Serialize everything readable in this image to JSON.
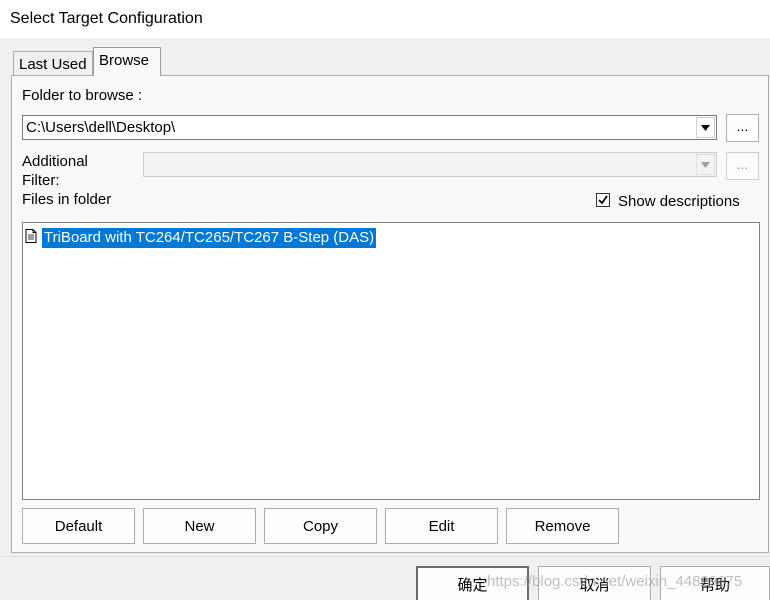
{
  "window": {
    "title": "Select Target Configuration"
  },
  "tabs": [
    {
      "label": "Last Used",
      "active": false
    },
    {
      "label": "Browse",
      "active": true
    }
  ],
  "folder": {
    "label": "Folder to browse :",
    "value": "C:\\Users\\dell\\Desktop\\",
    "browse_label": "..."
  },
  "filter": {
    "label_line1": "Additional",
    "label_line2": "Filter:",
    "value": "",
    "browse_label": "...",
    "enabled": false
  },
  "files": {
    "label": "Files in folder",
    "show_descriptions": {
      "label": "Show descriptions",
      "checked": true
    },
    "items": [
      {
        "text": "TriBoard with TC264/TC265/TC267 B-Step (DAS)",
        "selected": true,
        "icon": "document-icon"
      }
    ]
  },
  "buttons": {
    "default": "Default",
    "new": "New",
    "copy": "Copy",
    "edit": "Edit",
    "remove": "Remove"
  },
  "footer": {
    "ok": "确定",
    "cancel": "取消",
    "help": "帮助"
  },
  "watermark": "https://blog.csdn.net/weixin_44829675",
  "colors": {
    "selection": "#0078d7",
    "panel": "#f9f9f9",
    "window": "#f0f0f0"
  }
}
